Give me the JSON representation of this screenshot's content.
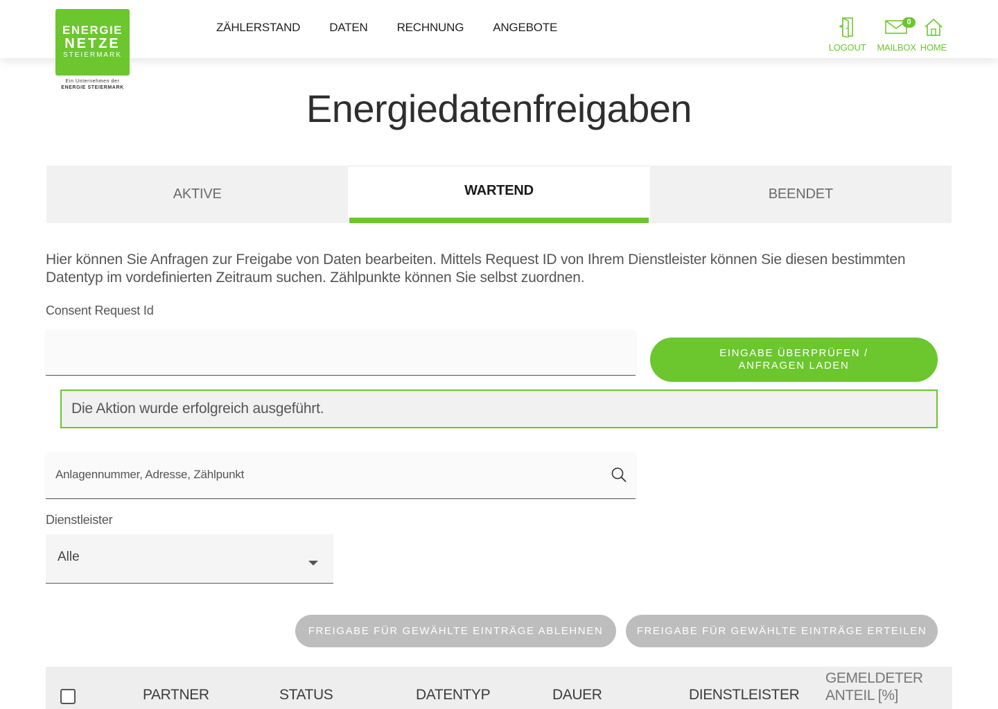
{
  "logo": {
    "line1": "ENERGIE",
    "line2": "NETZE",
    "line3": "STEIERMARK",
    "sub1": "Ein Unternehmen der",
    "sub2": "ENERGIE STEIERMARK"
  },
  "nav": [
    "ZÄHLERSTAND",
    "DATEN",
    "RECHNUNG",
    "ANGEBOTE"
  ],
  "header_actions": {
    "logout": "LOGOUT",
    "mailbox": "MAILBOX",
    "mailbox_count": "0",
    "home": "HOME"
  },
  "page_title": "Energiedatenfreigaben",
  "tabs": [
    {
      "label": "AKTIVE",
      "active": false
    },
    {
      "label": "WARTEND",
      "active": true
    },
    {
      "label": "BEENDET",
      "active": false
    }
  ],
  "intro_text": "Hier können Sie Anfragen zur Freigabe von Daten bearbeiten. Mittels Request ID von Ihrem Dienstleister können Sie diesen bestimmten Datentyp im vordefinierten Zeitraum suchen. Zählpunkte können Sie selbst zuordnen.",
  "consent": {
    "label": "Consent Request Id",
    "value": "",
    "button": "EINGABE ÜBERPRÜFEN / ANFRAGEN LADEN"
  },
  "success_message": "Die Aktion wurde erfolgreich ausgeführt.",
  "search": {
    "placeholder": "Anlagennummer, Adresse, Zählpunkt"
  },
  "provider": {
    "label": "Dienstleister",
    "selected": "Alle"
  },
  "actions": {
    "reject": "FREIGABE FÜR GEWÄHLTE EINTRÄGE ABLEHNEN",
    "grant": "FREIGABE FÜR GEWÄHLTE EINTRÄGE ERTEILEN"
  },
  "table": {
    "columns": [
      "PARTNER",
      "STATUS",
      "DATENTYP",
      "DAUER",
      "DIENSTLEISTER",
      "GEMELDETER",
      "ANTEIL [%]"
    ]
  },
  "colors": {
    "brand_green": "#6cc62e",
    "disabled_grey": "#bdbdbd"
  }
}
